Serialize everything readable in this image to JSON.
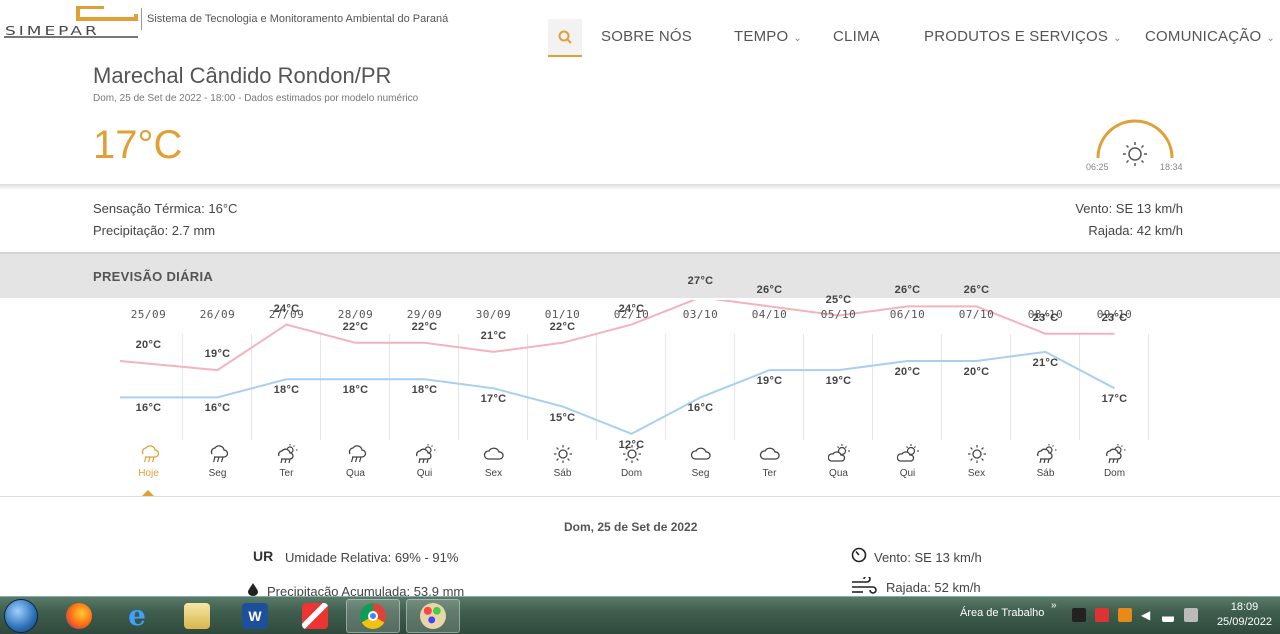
{
  "header": {
    "logo_text": "SIMEPAR",
    "org_name": "Sistema de Tecnologia e Monitoramento Ambiental do Paraná",
    "nav": [
      {
        "label": "SOBRE NÓS",
        "dropdown": false
      },
      {
        "label": "TEMPO",
        "dropdown": true
      },
      {
        "label": "CLIMA",
        "dropdown": false
      },
      {
        "label": "PRODUTOS E SERVIÇOS",
        "dropdown": true
      },
      {
        "label": "COMUNICAÇÃO",
        "dropdown": true
      }
    ]
  },
  "location": {
    "name": "Marechal Cândido Rondon/PR",
    "subtitle": "Dom, 25 de Set de 2022 - 18:00 - Dados estimados por modelo numérico",
    "temperature": "17°C",
    "sunrise": "06:25",
    "sunset": "18:34"
  },
  "current": {
    "feels_like": "Sensação Térmica: 16°C",
    "precipitation": "Precipitação: 2.7 mm",
    "wind": "Vento: SE 13 km/h",
    "gust": "Rajada: 42 km/h"
  },
  "forecast": {
    "title": "PREVISÃO DIÁRIA",
    "days": [
      {
        "date": "25/09",
        "max": "20°C",
        "min": "16°C",
        "label": "Hoje",
        "icon": "rain-icon",
        "active": true
      },
      {
        "date": "26/09",
        "max": "19°C",
        "min": "16°C",
        "label": "Seg",
        "icon": "rain-icon"
      },
      {
        "date": "27/09",
        "max": "24°C",
        "min": "18°C",
        "label": "Ter",
        "icon": "sun-rain-icon"
      },
      {
        "date": "28/09",
        "max": "22°C",
        "min": "18°C",
        "label": "Qua",
        "icon": "rain-icon"
      },
      {
        "date": "29/09",
        "max": "22°C",
        "min": "18°C",
        "label": "Qui",
        "icon": "sun-rain-icon"
      },
      {
        "date": "30/09",
        "max": "21°C",
        "min": "17°C",
        "label": "Sex",
        "icon": "cloud-icon"
      },
      {
        "date": "01/10",
        "max": "22°C",
        "min": "15°C",
        "label": "Sáb",
        "icon": "sun-icon"
      },
      {
        "date": "02/10",
        "max": "24°C",
        "min": "12°C",
        "label": "Dom",
        "icon": "sun-icon"
      },
      {
        "date": "03/10",
        "max": "27°C",
        "min": "16°C",
        "label": "Seg",
        "icon": "cloud-icon"
      },
      {
        "date": "04/10",
        "max": "26°C",
        "min": "19°C",
        "label": "Ter",
        "icon": "cloud-icon"
      },
      {
        "date": "05/10",
        "max": "25°C",
        "min": "19°C",
        "label": "Qua",
        "icon": "sun-cloud-icon"
      },
      {
        "date": "06/10",
        "max": "26°C",
        "min": "20°C",
        "label": "Qui",
        "icon": "sun-cloud-icon"
      },
      {
        "date": "07/10",
        "max": "26°C",
        "min": "20°C",
        "label": "Sex",
        "icon": "sun-icon"
      },
      {
        "date": "08/10",
        "max": "23°C",
        "min": "21°C",
        "label": "Sáb",
        "icon": "sun-rain-icon"
      },
      {
        "date": "09/10",
        "max": "23°C",
        "min": "17°C",
        "label": "Dom",
        "icon": "sun-rain-icon"
      }
    ],
    "max_values": [
      20,
      19,
      24,
      22,
      22,
      21,
      22,
      24,
      27,
      26,
      25,
      26,
      26,
      23,
      23
    ],
    "min_values": [
      16,
      16,
      18,
      18,
      18,
      17,
      15,
      12,
      16,
      19,
      19,
      20,
      20,
      21,
      17
    ],
    "colors": {
      "max_line": "#f4b3bb",
      "min_line": "#a9cff0",
      "accent": "#e0a035"
    }
  },
  "detail": {
    "date": "Dom, 25 de Set de 2022",
    "ur_abbr": "UR",
    "humidity": "Umidade Relativa: 69% - 91%",
    "precip_acc": "Precipitação Acumulada: 53.9 mm",
    "wind": "Vento: SE 13 km/h",
    "gust": "Rajada: 52 km/h"
  },
  "taskbar": {
    "apps": [
      "firefox-icon",
      "ie-icon",
      "explorer-icon",
      "word-icon",
      "ccleaner-icon",
      "chrome-icon",
      "paint-icon"
    ],
    "tray_label": "Área de Trabalho",
    "tray_chevron": "»",
    "time": "18:09",
    "date": "25/09/2022"
  }
}
